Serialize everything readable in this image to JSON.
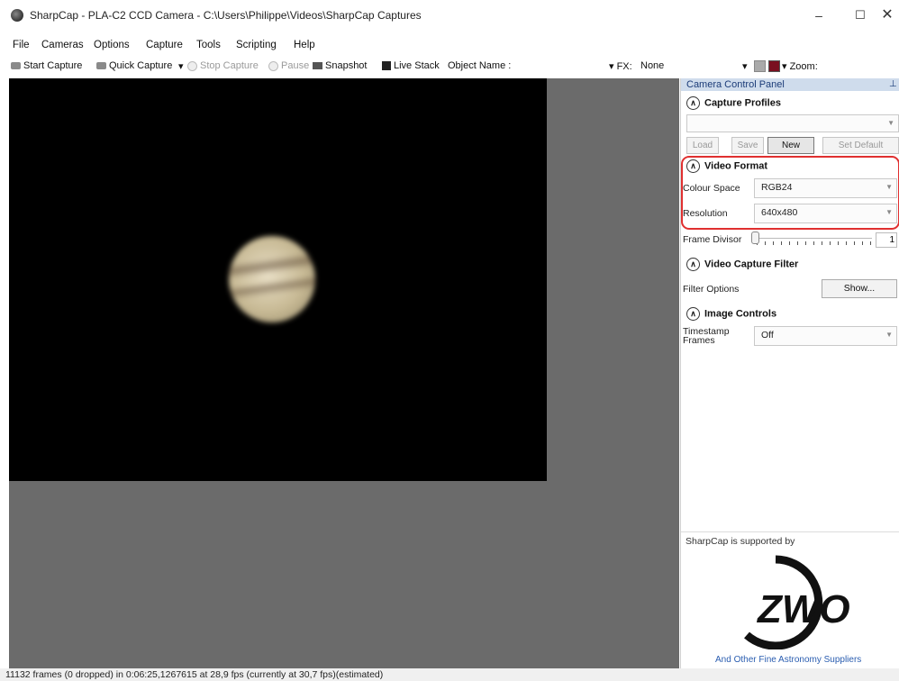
{
  "window": {
    "title": "SharpCap - PLA-C2 CCD Camera - C:\\Users\\Philippe\\Videos\\SharpCap Captures",
    "minimize": "–",
    "maximize": "☐",
    "close": "✕"
  },
  "menu": [
    "File",
    "Cameras",
    "Options",
    "Capture",
    "Tools",
    "Scripting",
    "Help"
  ],
  "toolbar": {
    "start_capture": "Start Capture",
    "quick_capture": "Quick Capture",
    "dropdown_arrow": "▾",
    "stop_capture": "Stop Capture",
    "pause": "Pause",
    "snapshot": "Snapshot",
    "live_stack": "Live Stack",
    "object_name_label": "Object Name :",
    "object_name_value": "",
    "fx_label": "▾ FX:",
    "fx_value": "None",
    "zoom_label": "▾ Zoom:"
  },
  "panel": {
    "title": "Camera Control Panel",
    "pin": "⊥",
    "capture_profiles": {
      "heading": "Capture Profiles",
      "selected": "",
      "buttons": [
        "Load",
        "Save",
        "New",
        "Set Default"
      ]
    },
    "video_format": {
      "heading": "Video Format",
      "colour_space_label": "Colour Space",
      "colour_space_value": "RGB24",
      "resolution_label": "Resolution",
      "resolution_value": "640x480"
    },
    "frame_divisor": {
      "label": "Frame Divisor",
      "value": "1"
    },
    "video_capture_filter": {
      "heading": "Video Capture Filter",
      "filter_options_label": "Filter Options",
      "show_button": "Show..."
    },
    "image_controls": {
      "heading": "Image Controls",
      "timestamp_label": "Timestamp Frames",
      "timestamp_value": "Off"
    },
    "support": {
      "text": "SharpCap is supported by",
      "logo_text": "ZWO",
      "link": "And Other Fine Astronomy Suppliers"
    }
  },
  "status": {
    "text": "11132 frames (0 dropped) in 0:06:25,1267615 at 28,9 fps  (currently at 30,7 fps)(estimated)"
  },
  "icons": {
    "collapse": "chevron-up-icon",
    "combo": "chevron-down-icon"
  },
  "colors": {
    "panel_header": "#cfdcec",
    "highlight": "#e03030",
    "link": "#2a5db0",
    "viewer_bg": "#6b6b6b"
  }
}
